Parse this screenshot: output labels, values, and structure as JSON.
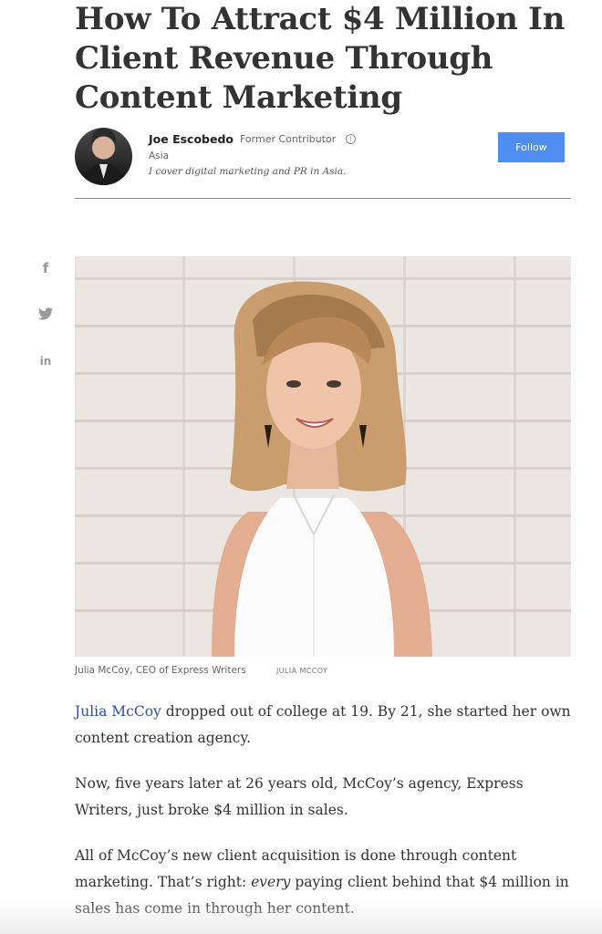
{
  "article": {
    "headline": "How To Attract $4 Million In Client Revenue Through Content Marketing"
  },
  "author": {
    "name": "Joe Escobedo",
    "role": "Former Contributor",
    "location": "Asia",
    "bio": "I cover digital marketing and PR in Asia.",
    "follow_label": "Follow",
    "info_icon": "info-icon"
  },
  "share": {
    "facebook": "f",
    "twitter": "🐦",
    "linkedin": "in"
  },
  "image": {
    "caption": "Julia McCoy, CEO of Express Writers",
    "credit": "JULIA MCCOY"
  },
  "body": {
    "p1_link": "Julia McCoy",
    "p1_rest": " dropped out of college at 19. By 21, she started her own content creation agency.",
    "p2": "Now, five years later at 26 years old, McCoy’s agency, Express Writers, just broke $4 million in sales.",
    "p3_a": "All of McCoy’s new client acquisition is done through content marketing. That’s right: ",
    "p3_em": "every",
    "p3_b": " paying client behind that $4 million in sales has come in through her content."
  },
  "colors": {
    "follow_button": "#4f8ef0",
    "link": "#2c4fa8"
  }
}
